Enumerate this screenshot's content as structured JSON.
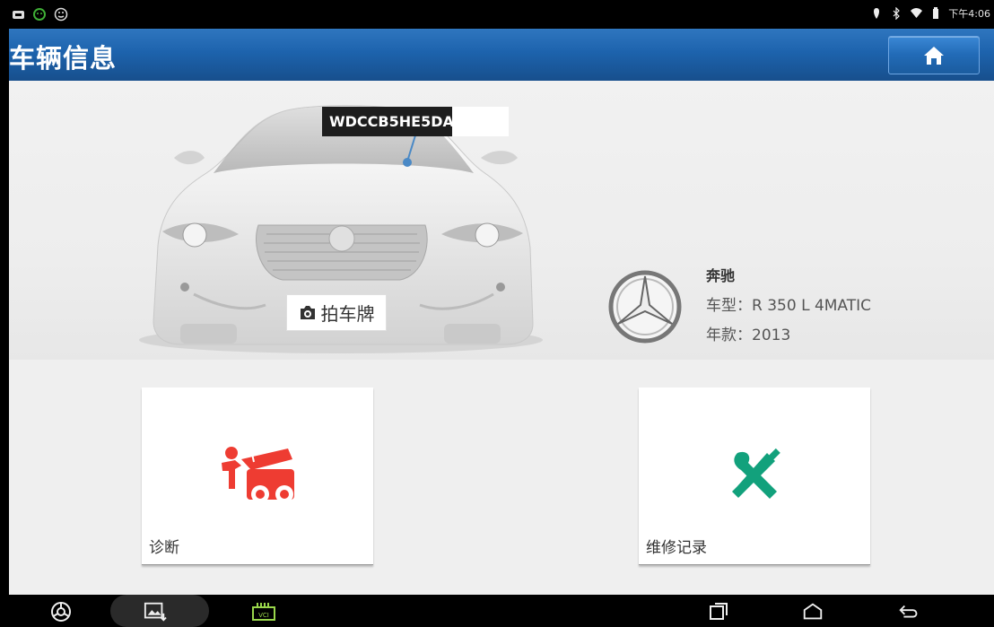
{
  "status_bar": {
    "left_icons": [
      "notification-icon",
      "android-icon",
      "smiley-icon"
    ],
    "right_icons": [
      "location-icon",
      "bluetooth-icon",
      "wifi-icon",
      "battery-icon"
    ],
    "time": "下午4:06"
  },
  "header": {
    "title": "车辆信息",
    "home_icon": "home-icon"
  },
  "vehicle": {
    "vin": "WDCCB5HE5DA",
    "capture_plate_label": "拍车牌",
    "brand_name": "奔驰",
    "model_line": "车型：R 350 L 4MATIC",
    "year_line": "年款：2013"
  },
  "functions": [
    {
      "label": "诊断",
      "icon": "diagnosis-icon",
      "color": "#ee3c32"
    },
    {
      "label": "维修记录",
      "icon": "repair-record-icon",
      "color": "#12a17c"
    }
  ],
  "nav_bar": {
    "icons": [
      "chrome-icon",
      "gallery-icon",
      "vci-icon",
      "recent-apps-icon",
      "home-nav-icon",
      "back-icon"
    ],
    "vci_label": "VCI"
  },
  "colors": {
    "header_blue": "#1d63ad",
    "diagnosis_red": "#ee3c32",
    "repair_green": "#12a17c"
  }
}
